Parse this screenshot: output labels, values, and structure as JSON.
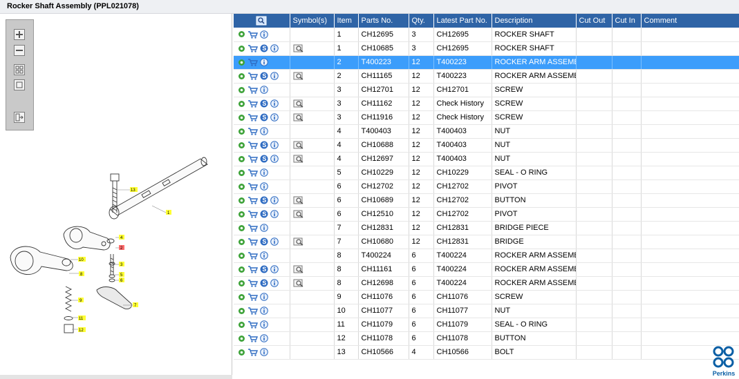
{
  "title": "Rocker Shaft Assembly (PPL021078)",
  "toolbar": {
    "buttons": [
      "zoom-in",
      "zoom-out",
      "fit-all",
      "fit-window",
      "export"
    ]
  },
  "table": {
    "columns": [
      "Symbol(s)",
      "Item",
      "Parts No.",
      "Qty.",
      "Latest Part No.",
      "Description",
      "Cut Out",
      "Cut In",
      "Comment"
    ],
    "selected_row": 2,
    "rows": [
      {
        "s": false,
        "sym": false,
        "item": "1",
        "part": "CH12695",
        "qty": "3",
        "latest": "CH12695",
        "desc": "ROCKER SHAFT"
      },
      {
        "s": true,
        "sym": true,
        "item": "1",
        "part": "CH10685",
        "qty": "3",
        "latest": "CH12695",
        "desc": "ROCKER SHAFT"
      },
      {
        "s": false,
        "sym": false,
        "item": "2",
        "part": "T400223",
        "qty": "12",
        "latest": "T400223",
        "desc": "ROCKER ARM ASSEMBL"
      },
      {
        "s": true,
        "sym": true,
        "item": "2",
        "part": "CH11165",
        "qty": "12",
        "latest": "T400223",
        "desc": "ROCKER ARM ASSEMBL"
      },
      {
        "s": false,
        "sym": false,
        "item": "3",
        "part": "CH12701",
        "qty": "12",
        "latest": "CH12701",
        "desc": "SCREW"
      },
      {
        "s": true,
        "sym": true,
        "item": "3",
        "part": "CH11162",
        "qty": "12",
        "latest": "Check History",
        "desc": "SCREW"
      },
      {
        "s": true,
        "sym": true,
        "item": "3",
        "part": "CH11916",
        "qty": "12",
        "latest": "Check History",
        "desc": "SCREW"
      },
      {
        "s": false,
        "sym": false,
        "item": "4",
        "part": "T400403",
        "qty": "12",
        "latest": "T400403",
        "desc": "NUT"
      },
      {
        "s": true,
        "sym": true,
        "item": "4",
        "part": "CH10688",
        "qty": "12",
        "latest": "T400403",
        "desc": "NUT"
      },
      {
        "s": true,
        "sym": true,
        "item": "4",
        "part": "CH12697",
        "qty": "12",
        "latest": "T400403",
        "desc": "NUT"
      },
      {
        "s": false,
        "sym": false,
        "item": "5",
        "part": "CH10229",
        "qty": "12",
        "latest": "CH10229",
        "desc": "SEAL - O RING"
      },
      {
        "s": false,
        "sym": false,
        "item": "6",
        "part": "CH12702",
        "qty": "12",
        "latest": "CH12702",
        "desc": "PIVOT"
      },
      {
        "s": true,
        "sym": true,
        "item": "6",
        "part": "CH10689",
        "qty": "12",
        "latest": "CH12702",
        "desc": "BUTTON"
      },
      {
        "s": true,
        "sym": true,
        "item": "6",
        "part": "CH12510",
        "qty": "12",
        "latest": "CH12702",
        "desc": "PIVOT"
      },
      {
        "s": false,
        "sym": false,
        "item": "7",
        "part": "CH12831",
        "qty": "12",
        "latest": "CH12831",
        "desc": "BRIDGE PIECE"
      },
      {
        "s": true,
        "sym": true,
        "item": "7",
        "part": "CH10680",
        "qty": "12",
        "latest": "CH12831",
        "desc": "BRIDGE"
      },
      {
        "s": false,
        "sym": false,
        "item": "8",
        "part": "T400224",
        "qty": "6",
        "latest": "T400224",
        "desc": "ROCKER ARM ASSEMBL"
      },
      {
        "s": true,
        "sym": true,
        "item": "8",
        "part": "CH11161",
        "qty": "6",
        "latest": "T400224",
        "desc": "ROCKER ARM ASSEMBL"
      },
      {
        "s": true,
        "sym": true,
        "item": "8",
        "part": "CH12698",
        "qty": "6",
        "latest": "T400224",
        "desc": "ROCKER ARM ASSEMBL"
      },
      {
        "s": false,
        "sym": false,
        "item": "9",
        "part": "CH11076",
        "qty": "6",
        "latest": "CH11076",
        "desc": "SCREW"
      },
      {
        "s": false,
        "sym": false,
        "item": "10",
        "part": "CH11077",
        "qty": "6",
        "latest": "CH11077",
        "desc": "NUT"
      },
      {
        "s": false,
        "sym": false,
        "item": "11",
        "part": "CH11079",
        "qty": "6",
        "latest": "CH11079",
        "desc": "SEAL - O RING"
      },
      {
        "s": false,
        "sym": false,
        "item": "12",
        "part": "CH11078",
        "qty": "6",
        "latest": "CH11078",
        "desc": "BUTTON"
      },
      {
        "s": false,
        "sym": false,
        "item": "13",
        "part": "CH10566",
        "qty": "4",
        "latest": "CH10566",
        "desc": "BOLT"
      }
    ]
  },
  "callouts": [
    "1",
    "2",
    "3",
    "4",
    "5",
    "6",
    "7",
    "8",
    "9",
    "10",
    "11",
    "12",
    "13"
  ],
  "logo": {
    "text": "Perkins",
    "color": "#0b5fa5"
  },
  "colors": {
    "header": "#2f64a6",
    "selected": "#3c9dfb",
    "callout": "#ffff33"
  }
}
